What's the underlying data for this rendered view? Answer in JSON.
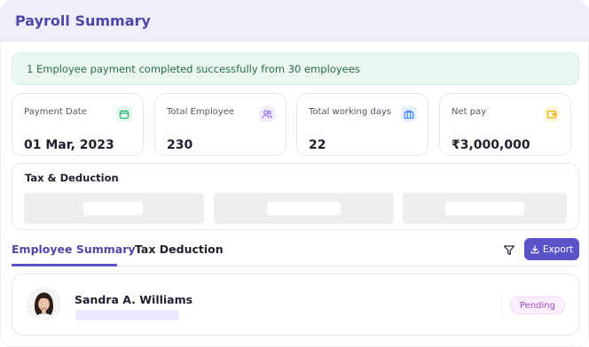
{
  "header": {
    "title": "Payroll Summary"
  },
  "banner": {
    "message": "1 Employee payment completed successfully from 30 employees"
  },
  "stats": [
    {
      "label": "Payment Date",
      "value": "01 Mar, 2023",
      "icon": "calendar-icon",
      "color": "#22b573"
    },
    {
      "label": "Total Employee",
      "value": "230",
      "icon": "users-icon",
      "color": "#8b5cf6"
    },
    {
      "label": "Total working days",
      "value": "22",
      "icon": "briefcase-icon",
      "color": "#3b82f6"
    },
    {
      "label": "Net pay",
      "value": "₹3,000,000",
      "icon": "wallet-icon",
      "color": "#e6a800"
    }
  ],
  "tax": {
    "title": "Tax & Deduction"
  },
  "tabs": [
    {
      "label": "Employee Summary",
      "active": true
    },
    {
      "label": "Tax Deduction",
      "active": false
    }
  ],
  "toolbar": {
    "export_label": "Export",
    "filter_icon": "filter-icon",
    "export_icon": "download-icon"
  },
  "employee": {
    "name": "Sandra A. Williams",
    "status": "Pending"
  },
  "colors": {
    "accent": "#5b52c9",
    "title": "#5146a6",
    "success_bg": "#eaf8f1",
    "pending": "#a048b8"
  }
}
